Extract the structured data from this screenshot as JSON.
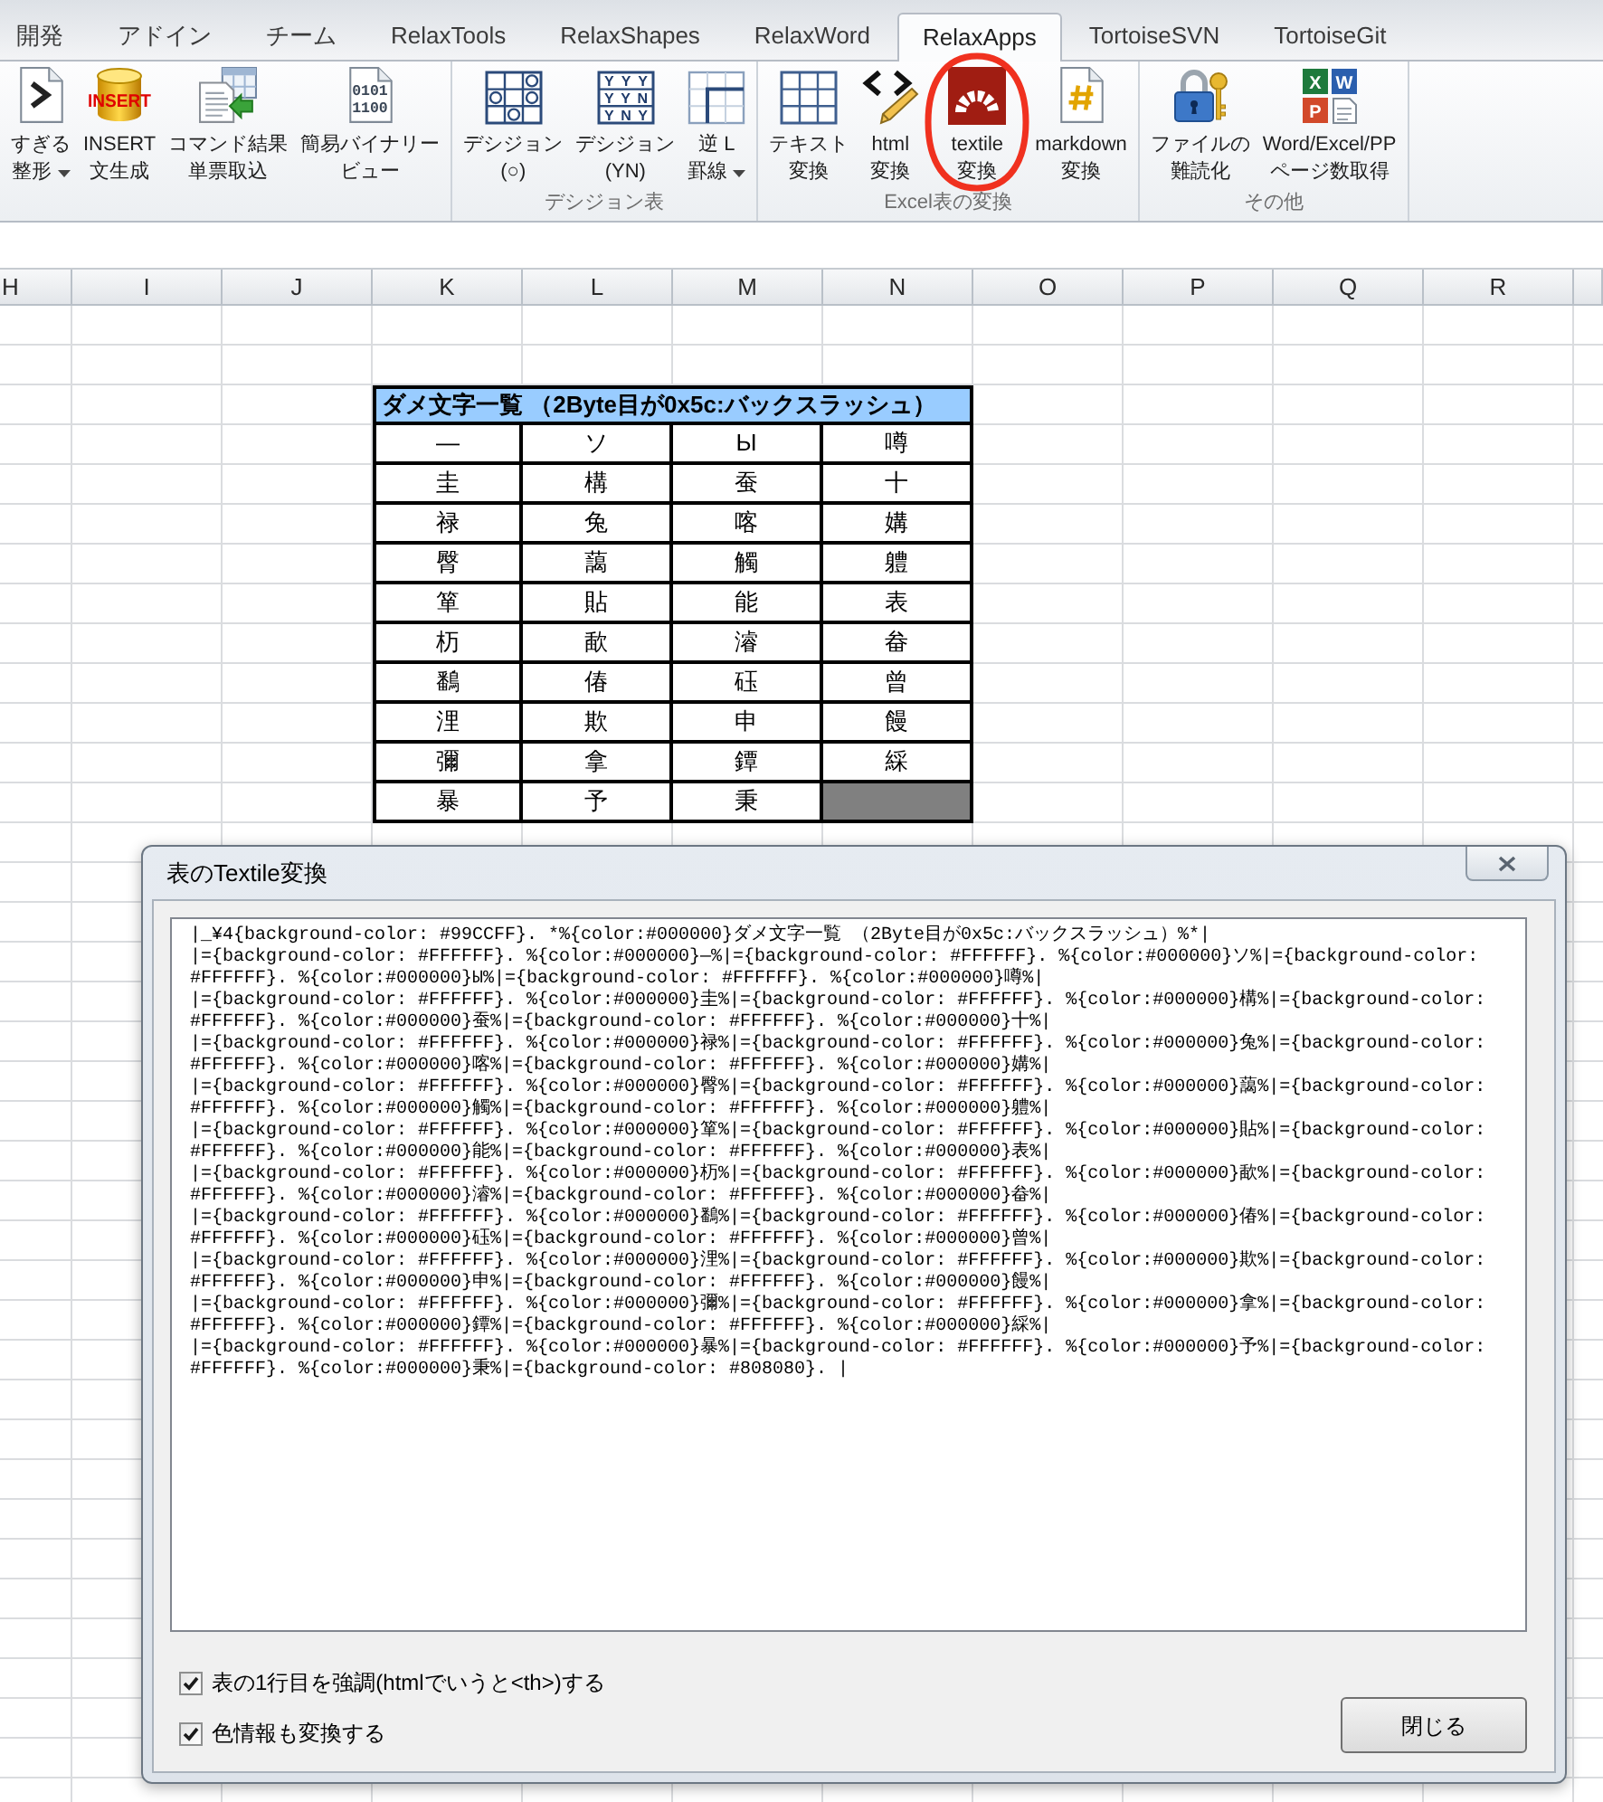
{
  "ribbon": {
    "tabs": [
      {
        "label": "開発",
        "selected": false
      },
      {
        "label": "アドイン",
        "selected": false
      },
      {
        "label": "チーム",
        "selected": false
      },
      {
        "label": "RelaxTools",
        "selected": false
      },
      {
        "label": "RelaxShapes",
        "selected": false
      },
      {
        "label": "RelaxWord",
        "selected": false
      },
      {
        "label": "RelaxApps",
        "selected": true
      },
      {
        "label": "TortoiseSVN",
        "selected": false
      },
      {
        "label": "TortoiseGit",
        "selected": false
      }
    ],
    "groups": [
      {
        "buttons": [
          {
            "kind": "doc-arrow",
            "lines": [
              "すぎる",
              "整形"
            ],
            "dropdown": true,
            "circled": false
          },
          {
            "kind": "insert",
            "icon_text": "INSERT",
            "lines": [
              "INSERT",
              "文生成"
            ],
            "dropdown": false,
            "circled": false
          },
          {
            "kind": "import",
            "lines": [
              "コマンド結果",
              "単票取込"
            ],
            "dropdown": false,
            "circled": false
          },
          {
            "kind": "binary",
            "icon_text": [
              "0101",
              "1100"
            ],
            "lines": [
              "簡易バイナリー",
              "ビュー"
            ],
            "dropdown": false,
            "circled": false
          }
        ]
      },
      {
        "label": "デシジョン表",
        "buttons": [
          {
            "kind": "circles",
            "lines": [
              "デシジョン",
              "(○)"
            ],
            "dropdown": false,
            "circled": false
          },
          {
            "kind": "yn",
            "icon_text": [
              "YYY",
              "YYN",
              "YNY"
            ],
            "lines": [
              "デシジョン",
              "(YN)"
            ],
            "dropdown": false,
            "circled": false
          },
          {
            "kind": "l-border",
            "lines": [
              "逆 L",
              "罫線"
            ],
            "dropdown": true,
            "circled": false
          }
        ]
      },
      {
        "label": "Excel表の変換",
        "buttons": [
          {
            "kind": "grid",
            "lines": [
              "テキスト",
              "変換"
            ],
            "dropdown": false,
            "circled": false
          },
          {
            "kind": "html",
            "lines": [
              "html",
              "変換"
            ],
            "dropdown": false,
            "circled": false
          },
          {
            "kind": "textile",
            "lines": [
              "textile",
              "変換"
            ],
            "dropdown": false,
            "circled": true
          },
          {
            "kind": "markdown",
            "lines": [
              "markdown",
              "変換"
            ],
            "dropdown": false,
            "circled": false
          }
        ]
      },
      {
        "label": "その他",
        "buttons": [
          {
            "kind": "lock",
            "lines": [
              "ファイルの",
              "難読化"
            ],
            "dropdown": false,
            "circled": false
          },
          {
            "kind": "office",
            "icon_text": [
              "X",
              "W",
              "P"
            ],
            "lines": [
              "Word/Excel/PP",
              "ページ数取得"
            ],
            "dropdown": false,
            "circled": false
          }
        ]
      }
    ]
  },
  "sheet": {
    "columns": [
      "H",
      "I",
      "J",
      "K",
      "L",
      "M",
      "N",
      "O",
      "P",
      "Q",
      "R"
    ],
    "table": {
      "title": {
        "text": "ダメ文字一覧 （2Byte目が0x5c:バックスラッシュ）",
        "color": "#99ccff"
      },
      "blank_cell": {
        "color": "#808080"
      },
      "rows": [
        [
          "―",
          "ソ",
          "Ы",
          "噂"
        ],
        [
          "圭",
          "構",
          "蚕",
          "十"
        ],
        [
          "禄",
          "兔",
          "喀",
          "媾"
        ],
        [
          "臀",
          "藹",
          "觸",
          "軆"
        ],
        [
          "箪",
          "貼",
          "能",
          "表"
        ],
        [
          "杤",
          "歃",
          "濬",
          "畚"
        ],
        [
          "鷭",
          "偆",
          "砡",
          "曾"
        ],
        [
          "浬",
          "欺",
          "申",
          "饅"
        ],
        [
          "彌",
          "拿",
          "鐔",
          "綵"
        ],
        [
          "暴",
          "予",
          "秉"
        ]
      ]
    }
  },
  "dialog": {
    "title": "表のTextile変換",
    "output_lines": [
      "|_¥4{background-color: #99CCFF}. *%{color:#000000}ダメ文字一覧 （2Byte目が0x5c:バックスラッシュ）%*|",
      "|={background-color: #FFFFFF}. %{color:#000000}―%|={background-color: #FFFFFF}. %{color:#000000}ソ%|={background-color:",
      "#FFFFFF}. %{color:#000000}Ы%|={background-color: #FFFFFF}. %{color:#000000}噂%|",
      "|={background-color: #FFFFFF}. %{color:#000000}圭%|={background-color: #FFFFFF}. %{color:#000000}構%|={background-color:",
      "#FFFFFF}. %{color:#000000}蚕%|={background-color: #FFFFFF}. %{color:#000000}十%|",
      "|={background-color: #FFFFFF}. %{color:#000000}禄%|={background-color: #FFFFFF}. %{color:#000000}兔%|={background-color:",
      "#FFFFFF}. %{color:#000000}喀%|={background-color: #FFFFFF}. %{color:#000000}媾%|",
      "|={background-color: #FFFFFF}. %{color:#000000}臀%|={background-color: #FFFFFF}. %{color:#000000}藹%|={background-color:",
      "#FFFFFF}. %{color:#000000}觸%|={background-color: #FFFFFF}. %{color:#000000}軆%|",
      "|={background-color: #FFFFFF}. %{color:#000000}箪%|={background-color: #FFFFFF}. %{color:#000000}貼%|={background-color:",
      "#FFFFFF}. %{color:#000000}能%|={background-color: #FFFFFF}. %{color:#000000}表%|",
      "|={background-color: #FFFFFF}. %{color:#000000}杤%|={background-color: #FFFFFF}. %{color:#000000}歃%|={background-color:",
      "#FFFFFF}. %{color:#000000}濬%|={background-color: #FFFFFF}. %{color:#000000}畚%|",
      "|={background-color: #FFFFFF}. %{color:#000000}鷭%|={background-color: #FFFFFF}. %{color:#000000}偆%|={background-color:",
      "#FFFFFF}. %{color:#000000}砡%|={background-color: #FFFFFF}. %{color:#000000}曾%|",
      "|={background-color: #FFFFFF}. %{color:#000000}浬%|={background-color: #FFFFFF}. %{color:#000000}欺%|={background-color:",
      "#FFFFFF}. %{color:#000000}申%|={background-color: #FFFFFF}. %{color:#000000}饅%|",
      "|={background-color: #FFFFFF}. %{color:#000000}彌%|={background-color: #FFFFFF}. %{color:#000000}拿%|={background-color:",
      "#FFFFFF}. %{color:#000000}鐔%|={background-color: #FFFFFF}. %{color:#000000}綵%|",
      "|={background-color: #FFFFFF}. %{color:#000000}暴%|={background-color: #FFFFFF}. %{color:#000000}予%|={background-color:",
      "#FFFFFF}. %{color:#000000}秉%|={background-color: #808080}. |"
    ],
    "options": [
      {
        "label": "表の1行目を強調(htmlでいうと<th>)する",
        "checked": true
      },
      {
        "label": "色情報も変換する",
        "checked": true
      }
    ],
    "close_button": "閉じる"
  }
}
